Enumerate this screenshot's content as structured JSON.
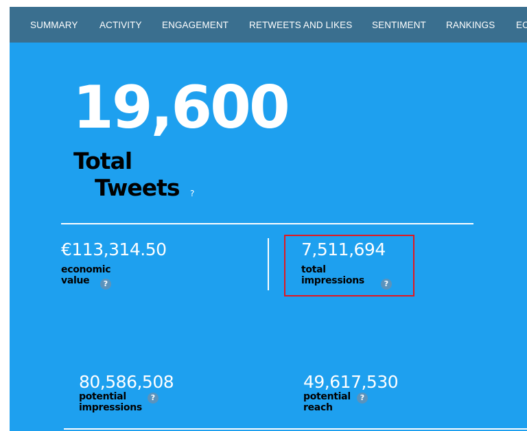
{
  "nav": {
    "items": [
      "SUMMARY",
      "ACTIVITY",
      "ENGAGEMENT",
      "RETWEETS AND LIKES",
      "SENTIMENT",
      "RANKINGS",
      "EC"
    ]
  },
  "hero": {
    "value": "19,600",
    "label_line1": "Total",
    "label_line2": "Tweets",
    "help": "?"
  },
  "stats": {
    "economic_value": {
      "value": "€113,314.50",
      "label_line1": "economic",
      "label_line2": "value",
      "help": "?"
    },
    "total_impressions": {
      "value": "7,511,694",
      "label_line1": "total",
      "label_line2": "impressions",
      "help": "?"
    },
    "potential_impressions": {
      "value": "80,586,508",
      "label_line1": "potential",
      "label_line2": "impressions",
      "help": "?"
    },
    "potential_reach": {
      "value": "49,617,530",
      "label_line1": "potential",
      "label_line2": "reach",
      "help": "?"
    }
  },
  "colors": {
    "background": "#1ea0ef",
    "nav_background": "#3a6f8f",
    "highlight": "#e3161d"
  }
}
